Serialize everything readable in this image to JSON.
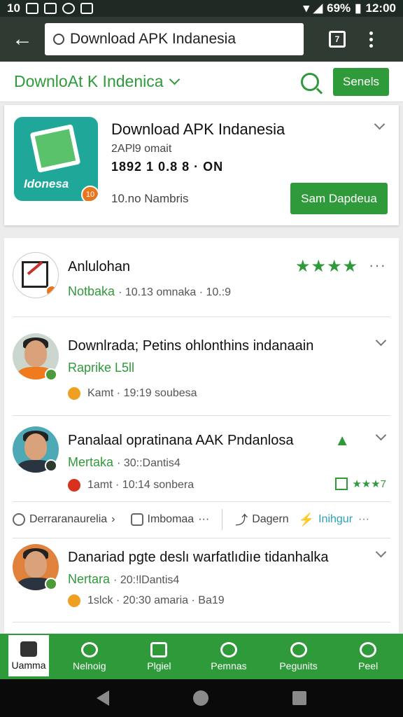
{
  "status_bar": {
    "left_text": "10",
    "battery": "69%",
    "time": "12:00"
  },
  "browser": {
    "url": "Download APK Indanesia",
    "tab_count": "7"
  },
  "site_header": {
    "title": "DownloAt K Indenica",
    "button_label": "Senels"
  },
  "app_card": {
    "logo_text": "Idonesa",
    "logo_badge": "10",
    "title": "Download APK Indanesia",
    "subtitle": "2APl9 omait",
    "meta": "1892 1 0.8 8 · ON",
    "members": "10.no Nambris",
    "button_label": "Sam Dapdeua"
  },
  "feed": [
    {
      "title": "Anlulohan",
      "sub_green": "Notbaka",
      "sub_grey": "· 10.13 omnaka · 10.:9",
      "stars": "★★★★",
      "more": "···"
    },
    {
      "title": "Downlrada; Petins ohlonthins indanaain",
      "sub_green": "Raprike L5ll",
      "meta": "Kamt · 19:19 soubesa"
    },
    {
      "title": "Panalaal opratinana AAK Pndanlosa",
      "sub_green": "Mertaka",
      "sub_grey": "· 30::Dantis4",
      "meta": "1amt · 10:14 sonbera",
      "rating_stars": "★★★7"
    },
    {
      "title": "Danariad pgte deslı warfatlıdiıe tidanhalka",
      "sub_green": "Nertara",
      "sub_grey": "· 20:!lDantis4",
      "meta": "1slck · 20:30 amaria · Ba19"
    }
  ],
  "actions": {
    "a1": "Derraranaurelia",
    "a2": "Imbomaa",
    "a3": "Dagern",
    "a4": "Inihgur",
    "more": "···"
  },
  "bottom_nav": [
    {
      "label": "Uamma"
    },
    {
      "label": "Nelnoig"
    },
    {
      "label": "Plgiel"
    },
    {
      "label": "Pemnas"
    },
    {
      "label": "Pegunits"
    },
    {
      "label": "Peel"
    }
  ],
  "colors": {
    "accent": "#2f9a3a",
    "toolbar": "#2f3a33",
    "status_bar": "#1f2a24"
  }
}
